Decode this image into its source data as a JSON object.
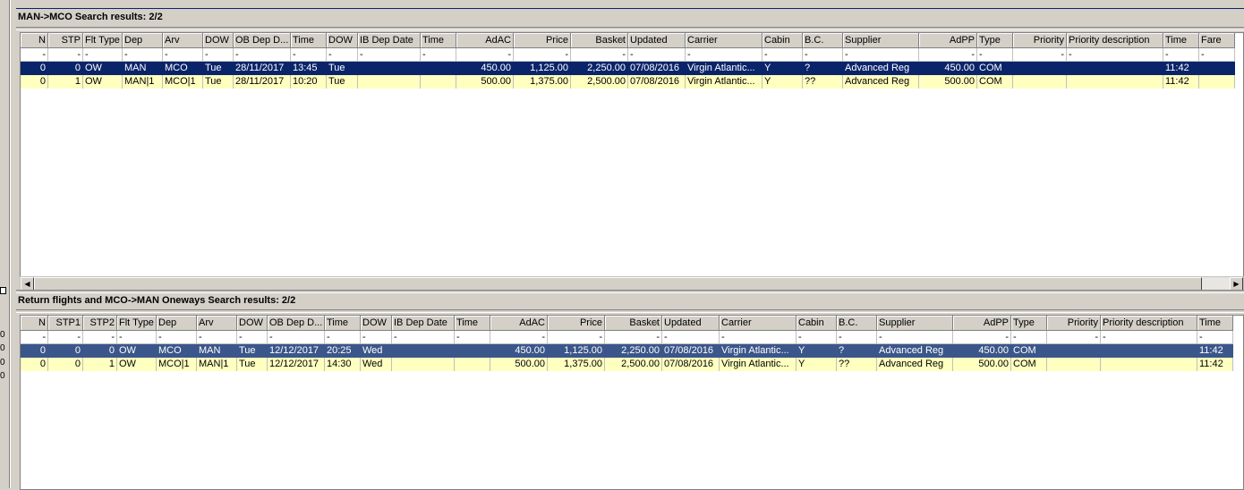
{
  "left_strip": {
    "box_text": "",
    "values": [
      "0",
      "0",
      "0",
      "0"
    ]
  },
  "outbound": {
    "title": "MAN->MCO Search results: 2/2",
    "columns": [
      "N",
      "STP",
      "Flt Type",
      "Dep",
      "Arv",
      "DOW",
      "OB Dep D...",
      "Time",
      "DOW",
      "IB Dep Date",
      "Time",
      "AdAC",
      "Price",
      "Basket",
      "Updated",
      "Carrier",
      "Cabin",
      "B.C.",
      "Supplier",
      "AdPP",
      "Type",
      "Priority",
      "Priority description",
      "Time",
      "Fare"
    ],
    "filter": [
      "-",
      "-",
      "-",
      "-",
      "-",
      "-",
      "-",
      "-",
      "-",
      "-",
      "-",
      "-",
      "-",
      "-",
      "-",
      "-",
      "-",
      "-",
      "-",
      "-",
      "-",
      "-",
      "-",
      "-",
      "-"
    ],
    "rows": [
      [
        "0",
        "0",
        "OW",
        "MAN",
        "MCO",
        "Tue",
        "28/11/2017",
        "13:45",
        "Tue",
        "",
        "",
        "450.00",
        "1,125.00",
        "2,250.00",
        "07/08/2016",
        "Virgin Atlantic...",
        "Y",
        "?",
        "Advanced Reg",
        "450.00",
        "COM",
        "",
        "",
        "11:42",
        ""
      ],
      [
        "0",
        "1",
        "OW",
        "MAN|1",
        "MCO|1",
        "Tue",
        "28/11/2017",
        "10:20",
        "Tue",
        "",
        "",
        "500.00",
        "1,375.00",
        "2,500.00",
        "07/08/2016",
        "Virgin Atlantic...",
        "Y",
        "??",
        "Advanced Reg",
        "500.00",
        "COM",
        "",
        "",
        "11:42",
        ""
      ]
    ]
  },
  "inbound": {
    "title": "Return flights and MCO->MAN Oneways Search results: 2/2",
    "columns": [
      "N",
      "STP1",
      "STP2",
      "Flt Type",
      "Dep",
      "Arv",
      "DOW",
      "OB Dep D...",
      "Time",
      "DOW",
      "IB Dep Date",
      "Time",
      "AdAC",
      "Price",
      "Basket",
      "Updated",
      "Carrier",
      "Cabin",
      "B.C.",
      "Supplier",
      "AdPP",
      "Type",
      "Priority",
      "Priority description",
      "Time"
    ],
    "filter": [
      "-",
      "-",
      "-",
      "-",
      "-",
      "-",
      "-",
      "-",
      "-",
      "-",
      "-",
      "-",
      "-",
      "-",
      "-",
      "-",
      "-",
      "-",
      "-",
      "-",
      "-",
      "-",
      "-",
      "-",
      "-"
    ],
    "rows": [
      [
        "0",
        "0",
        "0",
        "OW",
        "MCO",
        "MAN",
        "Tue",
        "12/12/2017",
        "20:25",
        "Wed",
        "",
        "",
        "450.00",
        "1,125.00",
        "2,250.00",
        "07/08/2016",
        "Virgin Atlantic...",
        "Y",
        "?",
        "Advanced Reg",
        "450.00",
        "COM",
        "",
        "",
        "11:42"
      ],
      [
        "0",
        "0",
        "1",
        "OW",
        "MCO|1",
        "MAN|1",
        "Tue",
        "12/12/2017",
        "14:30",
        "Wed",
        "",
        "",
        "500.00",
        "1,375.00",
        "2,500.00",
        "07/08/2016",
        "Virgin Atlantic...",
        "Y",
        "??",
        "Advanced Reg",
        "500.00",
        "COM",
        "",
        "",
        "11:42"
      ]
    ]
  },
  "colors": {
    "selected_dark": "#0a246a",
    "selected_mid": "#3b568a",
    "row_highlight": "#ffffc0",
    "header_bg": "#d4d0c8"
  }
}
